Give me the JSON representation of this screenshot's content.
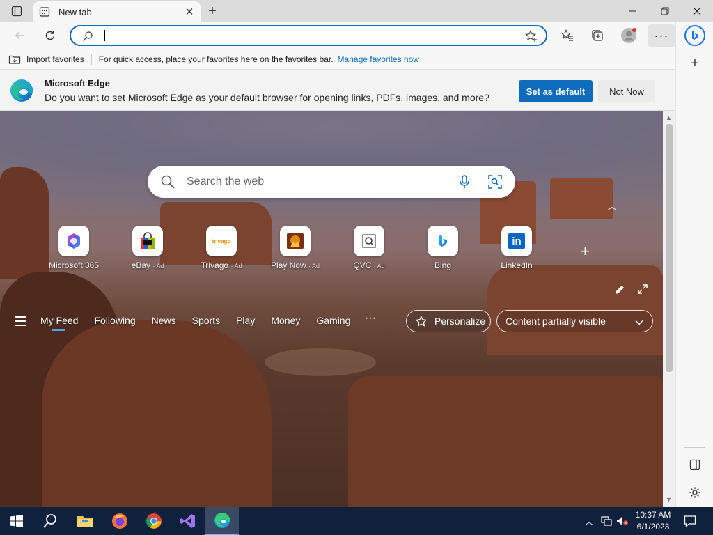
{
  "window": {
    "tab_title": "New tab"
  },
  "toolbar": {
    "address_value": "",
    "address_placeholder": ""
  },
  "favorites_bar": {
    "import_label": "Import favorites",
    "hint": "For quick access, place your favorites here on the favorites bar.",
    "manage_link": "Manage favorites now"
  },
  "banner": {
    "title": "Microsoft Edge",
    "message": "Do you want to set Microsoft Edge as your default browser for opening links, PDFs, images, and more?",
    "primary_button": "Set as default",
    "secondary_button": "Not Now"
  },
  "newtab": {
    "search_placeholder": "Search the web",
    "tiles": [
      {
        "label": "Microsoft 365",
        "ad": "",
        "icon": "microsoft-365-icon"
      },
      {
        "label": "eBay",
        "ad": "· Ad",
        "icon": "ebay-icon"
      },
      {
        "label": "Trivago",
        "ad": "· Ad",
        "icon": "trivago-icon"
      },
      {
        "label": "Play Now",
        "ad": "· Ad",
        "icon": "play-now-icon"
      },
      {
        "label": "QVC",
        "ad": "· Ad",
        "icon": "qvc-icon"
      },
      {
        "label": "Bing",
        "ad": "",
        "icon": "bing-icon"
      },
      {
        "label": "LinkedIn",
        "ad": "",
        "icon": "linkedin-icon"
      }
    ],
    "trivago_text": "trivago",
    "linkedin_text": "in"
  },
  "feed": {
    "tabs": [
      "My Feed",
      "Following",
      "News",
      "Sports",
      "Play",
      "Money",
      "Gaming"
    ],
    "more": "···",
    "personalize": "Personalize",
    "content_visibility": "Content partially visible"
  },
  "taskbar": {
    "time": "10:37 AM",
    "date": "6/1/2023"
  },
  "colors": {
    "accent": "#0f6cbd",
    "taskbar": "#10213d"
  }
}
